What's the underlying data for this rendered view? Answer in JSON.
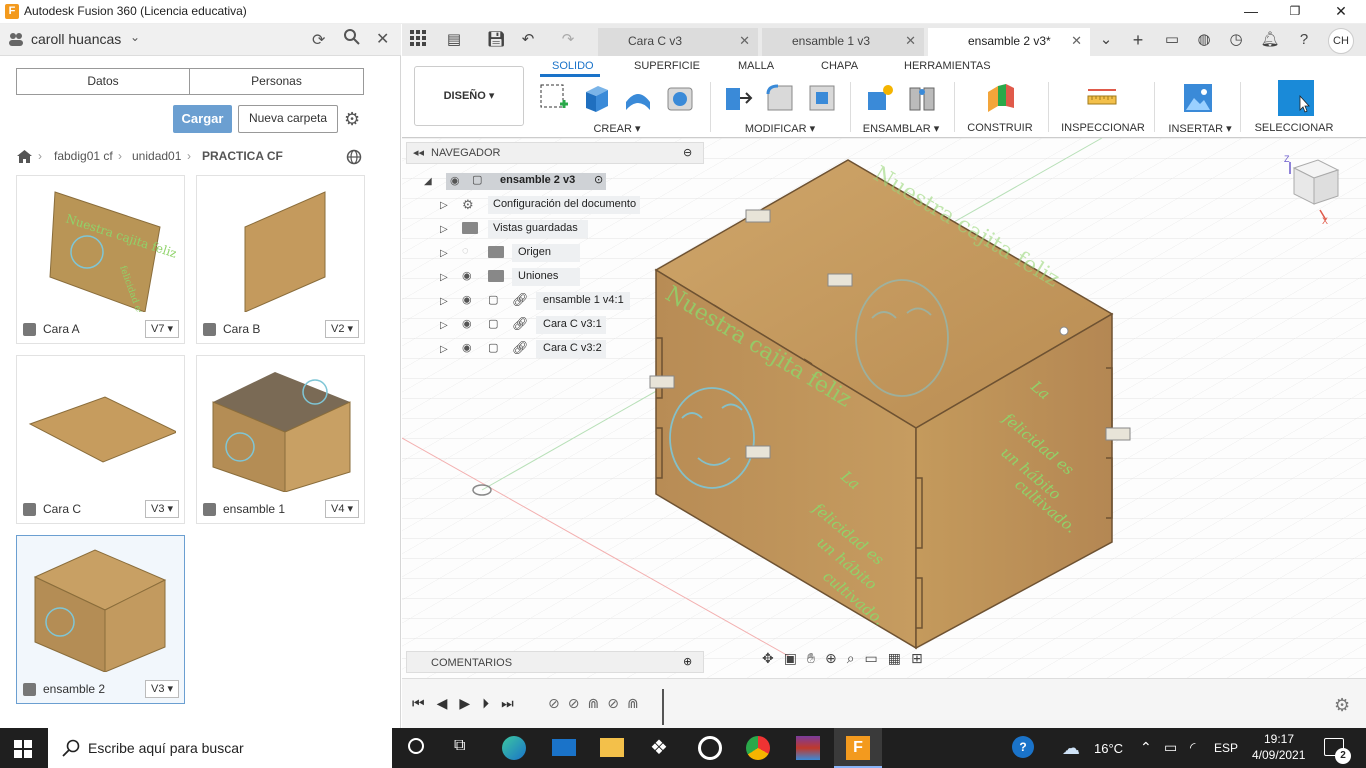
{
  "window": {
    "title": "Autodesk Fusion 360 (Licencia educativa)",
    "minimize": "—",
    "maximize": "❐",
    "close": "✕"
  },
  "left_panel": {
    "user": "caroll huancas",
    "tabs": [
      "Datos",
      "Personas"
    ],
    "upload_label": "Cargar",
    "new_folder_label": "Nueva carpeta",
    "breadcrumb": [
      "fabdig01 cf",
      "unidad01",
      "PRACTICA CF"
    ],
    "files": [
      {
        "name": "Cara A",
        "version": "V7"
      },
      {
        "name": "Cara B",
        "version": "V2"
      },
      {
        "name": "Cara C",
        "version": "V3"
      },
      {
        "name": "ensamble 1",
        "version": "V4"
      },
      {
        "name": "ensamble 2",
        "version": "V3"
      }
    ]
  },
  "doc_tabs": [
    {
      "label": "Cara C v3",
      "active": false
    },
    {
      "label": "ensamble 1 v3",
      "active": false
    },
    {
      "label": "ensamble 2 v3*",
      "active": true
    }
  ],
  "user_initials": "CH",
  "ribbon": {
    "workspace": "DISEÑO",
    "tabs": [
      "SOLIDO",
      "SUPERFICIE",
      "MALLA",
      "CHAPA",
      "HERRAMIENTAS"
    ],
    "active_tab": "SOLIDO",
    "groups": [
      "CREAR",
      "MODIFICAR",
      "ENSAMBLAR",
      "CONSTRUIR",
      "INSPECCIONAR",
      "INSERTAR",
      "SELECCIONAR"
    ]
  },
  "browser": {
    "title": "NAVEGADOR",
    "root": "ensamble 2 v3",
    "items": [
      "Configuración del documento",
      "Vistas guardadas",
      "Origen",
      "Uniones",
      "ensamble 1 v4:1",
      "Cara C v3:1",
      "Cara C v3:2"
    ],
    "comments": "COMENTARIOS"
  },
  "model": {
    "engraving_title": "Nuestra cajita feliz",
    "engraving_quote": "La felicidad es un hábito cultivado.",
    "viewcube_axis_z": "Z",
    "viewcube_axis_x": "X"
  },
  "taskbar": {
    "search_placeholder": "Escribe aquí para buscar",
    "temperature": "16°C",
    "language": "ESP",
    "time": "19:17",
    "date": "4/09/2021",
    "notifications": "2"
  },
  "colors": {
    "accent": "#1a73c9",
    "wood": "#c89c5e",
    "engraving_green": "#8fd36a",
    "engraving_cyan": "#7fc6d6"
  }
}
